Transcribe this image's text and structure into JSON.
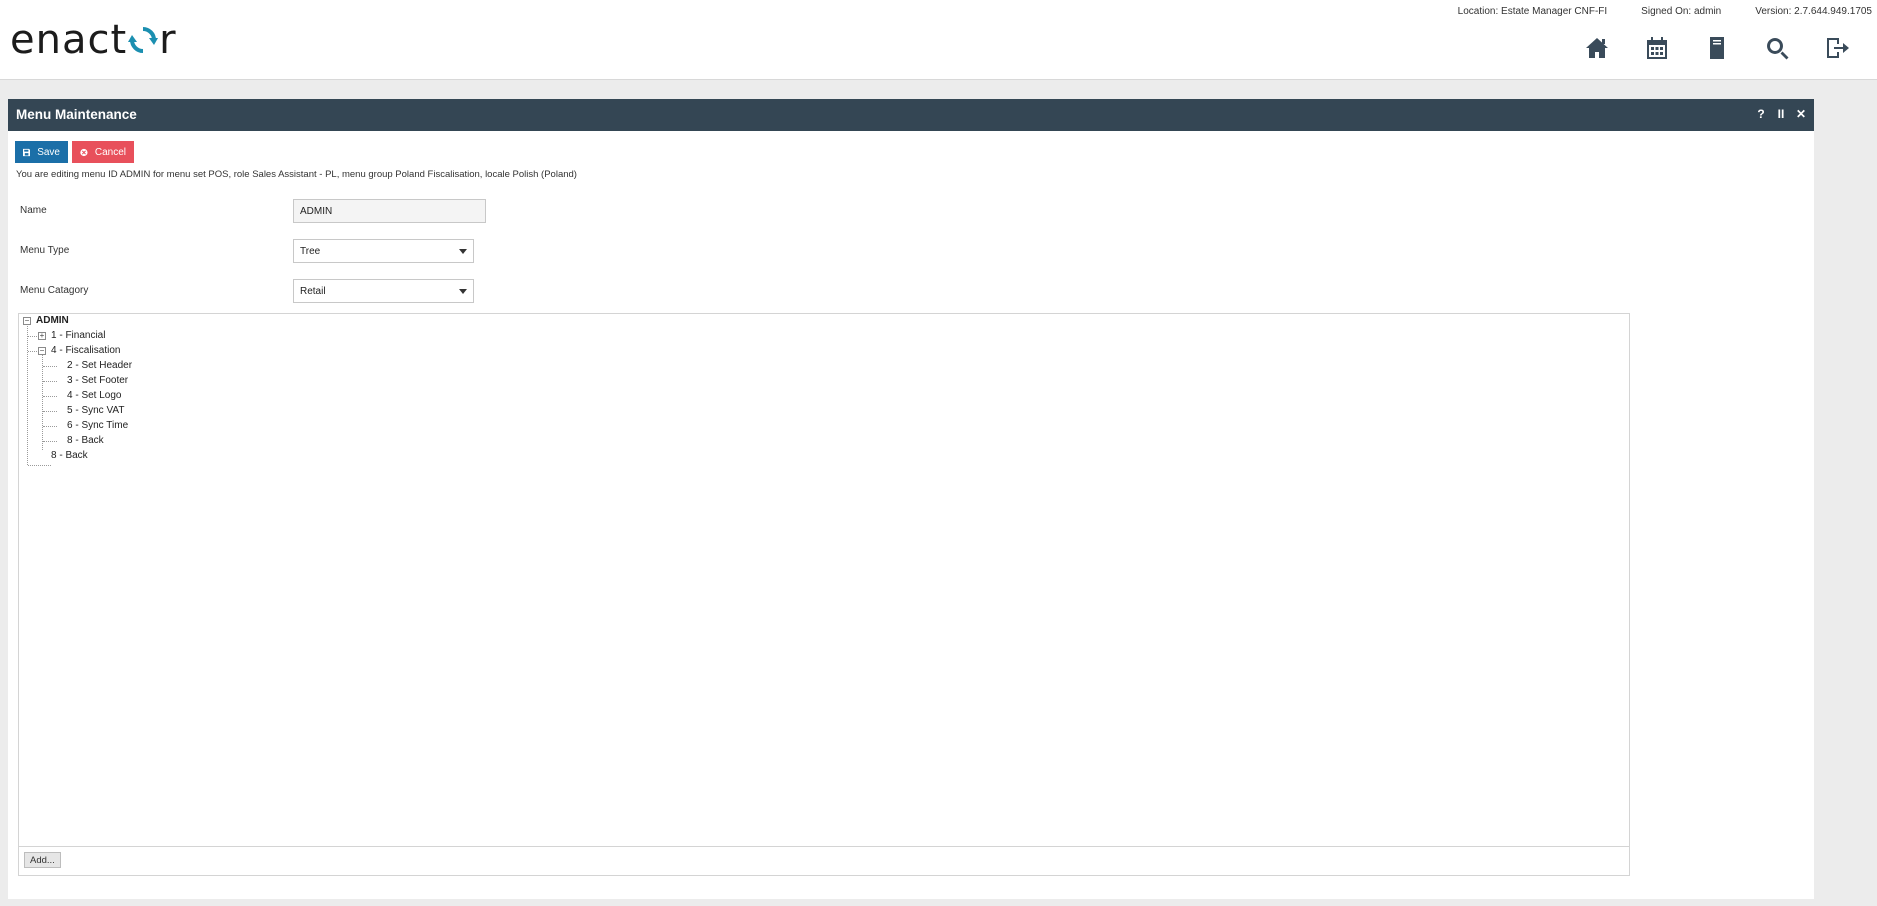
{
  "header": {
    "logo_text_before": "enact",
    "logo_text_after": "r",
    "location": "Location: Estate Manager CNF-FI",
    "signed_on": "Signed On: admin",
    "version": "Version: 2.7.644.949.1705",
    "icons": [
      "home-icon",
      "calendar-icon",
      "document-icon",
      "search-icon",
      "logout-icon"
    ]
  },
  "panel": {
    "title": "Menu Maintenance",
    "controls": {
      "help": "?",
      "pause": "II",
      "close": "✕"
    }
  },
  "toolbar": {
    "save_label": "Save",
    "cancel_label": "Cancel"
  },
  "info_text": "You are editing menu ID ADMIN for menu set POS, role Sales Assistant - PL, menu group Poland Fiscalisation, locale Polish (Poland)",
  "form": {
    "name_label": "Name",
    "name_value": "ADMIN",
    "menu_type_label": "Menu Type",
    "menu_type_value": "Tree",
    "menu_category_label": "Menu Catagory",
    "menu_category_value": "Retail"
  },
  "tree": {
    "root": {
      "label": "ADMIN",
      "expanded": true
    },
    "nodes": [
      {
        "label": "1 - Financial",
        "level": 1,
        "expanded": false,
        "has_children": true
      },
      {
        "label": "4 - Fiscalisation",
        "level": 1,
        "expanded": true,
        "has_children": true
      },
      {
        "label": "2 - Set Header",
        "level": 2
      },
      {
        "label": "3 - Set Footer",
        "level": 2
      },
      {
        "label": "4 - Set Logo",
        "level": 2
      },
      {
        "label": "5 - Sync VAT",
        "level": 2
      },
      {
        "label": "6 - Sync Time",
        "level": 2
      },
      {
        "label": "8 - Back",
        "level": 2
      },
      {
        "label": "8 - Back",
        "level": 1
      }
    ],
    "add_label": "Add..."
  },
  "colors": {
    "titlebar": "#344654",
    "save": "#1b6fa8",
    "cancel": "#e8505b",
    "logo_accent": "#1b8fb0"
  }
}
